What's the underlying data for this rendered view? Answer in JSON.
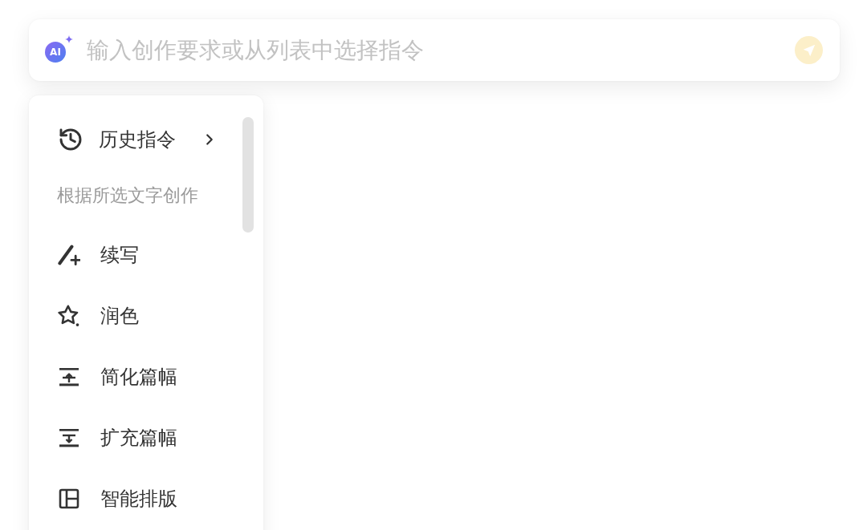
{
  "command_bar": {
    "logo_text": "AI",
    "placeholder": "输入创作要求或从列表中选择指令",
    "send_button": {
      "disabled": true
    }
  },
  "menu": {
    "items": [
      {
        "kind": "submenu",
        "label": "历史指令"
      },
      {
        "kind": "heading",
        "label": "根据所选文字创作"
      },
      {
        "kind": "command",
        "label": "续写"
      },
      {
        "kind": "command",
        "label": "润色"
      },
      {
        "kind": "command",
        "label": "简化篇幅"
      },
      {
        "kind": "command",
        "label": "扩充篇幅"
      },
      {
        "kind": "command",
        "label": "智能排版"
      }
    ]
  }
}
